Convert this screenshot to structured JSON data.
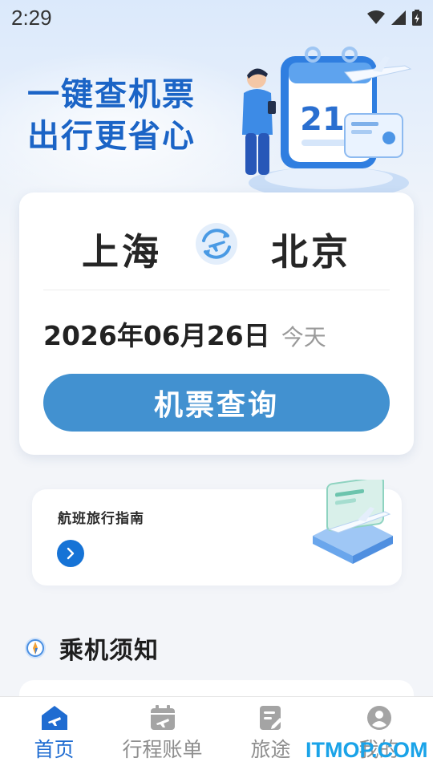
{
  "status_bar": {
    "time": "2:29"
  },
  "hero": {
    "slogan_line1": "一键查机票",
    "slogan_line2": "出行更省心",
    "calendar_day": "21"
  },
  "search": {
    "from_city": "上海",
    "to_city": "北京",
    "date": "2026年06月26日",
    "date_hint": "今天",
    "button_label": "机票查询"
  },
  "guide": {
    "title": "航班旅行指南"
  },
  "notice": {
    "title": "乘机须知"
  },
  "tabs": [
    {
      "label": "首页",
      "icon": "plane-house-icon",
      "active": true
    },
    {
      "label": "行程账单",
      "icon": "calendar-plane-icon",
      "active": false
    },
    {
      "label": "旅途",
      "icon": "note-edit-icon",
      "active": false
    },
    {
      "label": "我的",
      "icon": "user-icon",
      "active": false
    }
  ],
  "watermark": "ITMOP.COM",
  "colors": {
    "accent": "#4291d0",
    "slogan": "#1b64c6",
    "tab_active": "#1f6cd1",
    "guide_arrow": "#1673d6"
  }
}
